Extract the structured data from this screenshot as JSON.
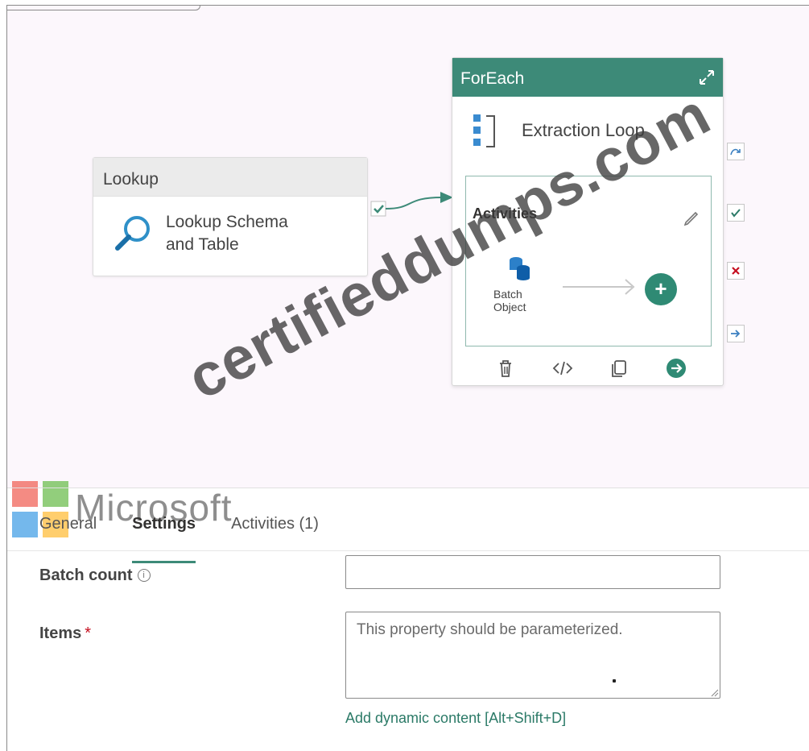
{
  "canvas": {
    "lookup": {
      "header": "Lookup",
      "name_line1": "Lookup Schema",
      "name_line2": "and Table"
    },
    "foreach": {
      "header": "ForEach",
      "name": "Extraction Loop",
      "activities_label": "Activities",
      "inner_activity_line1": "Batch",
      "inner_activity_line2": "Object",
      "toolbar": [
        "delete-icon",
        "code-icon",
        "copy-icon",
        "go-icon"
      ]
    },
    "side_handles": [
      "skip",
      "success",
      "failure",
      "completion"
    ],
    "watermark": "certifieddumps.com",
    "logo_text": "Microsoft"
  },
  "tabs": [
    {
      "label": "General",
      "active": false
    },
    {
      "label": "Settings",
      "active": true
    },
    {
      "label": "Activities (1)",
      "active": false
    }
  ],
  "settings": {
    "batch_count_label": "Batch count",
    "batch_count_value": "",
    "items_label": "Items",
    "items_required_marker": "*",
    "items_placeholder": "This property should be parameterized.",
    "dynamic_content_link": "Add dynamic content [Alt+Shift+D]"
  },
  "colors": {
    "accent": "#3d8a78",
    "add_button": "#2f8a74",
    "failure": "#c50f1f",
    "success": "#2b7a67"
  }
}
